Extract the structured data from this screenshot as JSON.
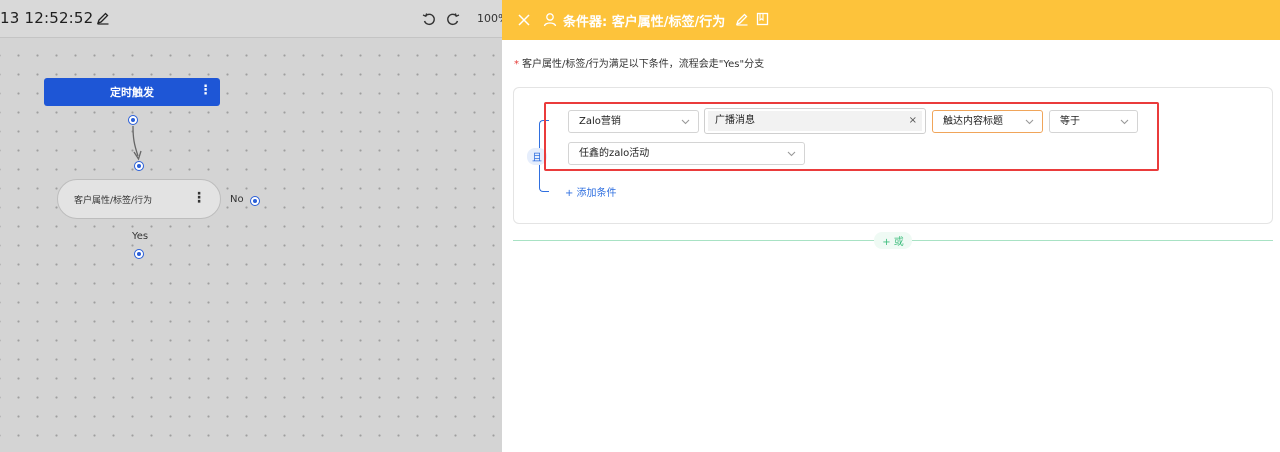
{
  "canvas": {
    "timestamp": "13 12:52:52",
    "zoom": "100%",
    "nodes": {
      "trigger_label": "定时触发",
      "condition_label": "客户属性/标签/行为",
      "kebab": "⋮"
    },
    "edges": {
      "no_label": "No",
      "yes_label": "Yes"
    }
  },
  "panel": {
    "title": "条件器: 客户属性/标签/行为",
    "rule_required_mark": "*",
    "rule_text": "客户属性/标签/行为满足以下条件，流程会走\"Yes\"分支",
    "and_label": "且",
    "conditions": {
      "category": "Zalo营销",
      "tag_value": "广播消息",
      "tag_remove": "×",
      "field": "触达内容标题",
      "operator": "等于",
      "value": "任鑫的zalo活动"
    },
    "add_condition": "+ 添加条件",
    "or_button": "+ 或"
  },
  "colors": {
    "header_bg": "#fdc33b",
    "trigger_node": "#1e56d6",
    "accent_blue": "#2f6fe0",
    "highlight_red": "#ea3b3b",
    "or_green": "#3dbd7d"
  }
}
